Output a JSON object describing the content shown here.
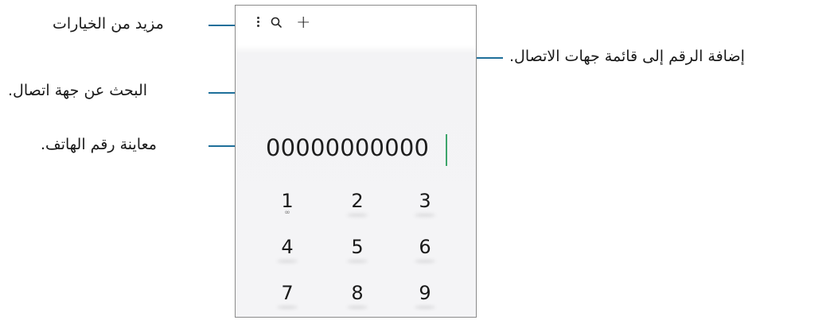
{
  "callouts": {
    "more_options": "مزيد من الخيارات",
    "search_contact": "البحث عن جهة اتصال.",
    "number_preview": "معاينة رقم الهاتف.",
    "add_to_contacts": "إضافة الرقم إلى قائمة جهات الاتصال."
  },
  "dialer": {
    "number": "00000000000",
    "keys": [
      "1",
      "2",
      "3",
      "4",
      "5",
      "6",
      "7",
      "8",
      "9"
    ],
    "voicemail_glyph": "∞"
  },
  "icons": {
    "more": "more-options-icon",
    "search": "search-icon",
    "add": "plus-icon"
  },
  "colors": {
    "callout_line": "#1e6f9a",
    "cursor": "#3ea56b",
    "frame": "#8a8a8a"
  }
}
